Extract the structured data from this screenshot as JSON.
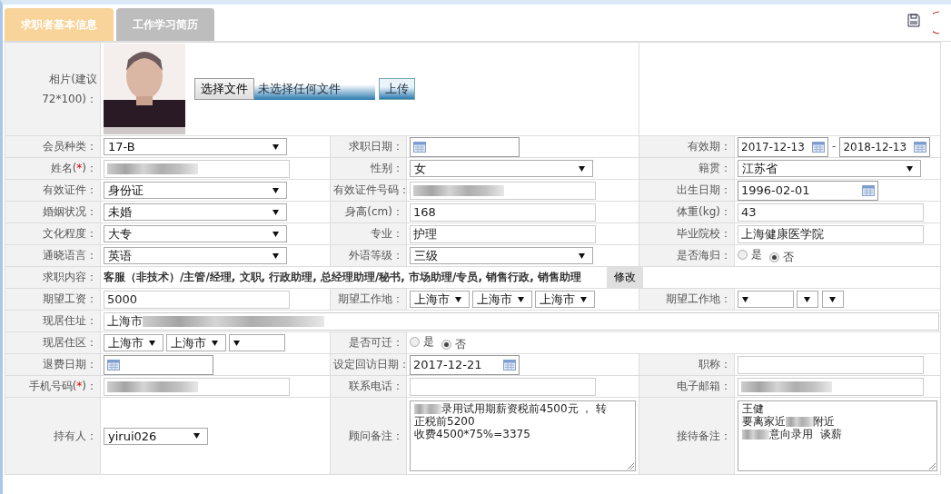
{
  "tabs": [
    {
      "label": "求职者基本信息",
      "selected": true
    },
    {
      "label": "工作学习简历",
      "selected": false
    }
  ],
  "photo": {
    "label_lines": [
      "相片(建议",
      "72*100)："
    ],
    "file_button": "选择文件",
    "file_status": "未选择任何文件",
    "upload_button": "上传"
  },
  "rows": [
    {
      "cells": [
        {
          "label": "会员种类：",
          "kind": "select",
          "value": "17-B"
        },
        {
          "label": "求职日期：",
          "kind": "date"
        },
        {
          "label": "有效期：",
          "kind": "daterange",
          "from": "2017-12-13",
          "separator": "-",
          "to": "2018-12-13"
        }
      ]
    },
    {
      "cells": [
        {
          "label": "姓名(",
          "required_mark": "*",
          "label_end": ")：",
          "kind": "text",
          "redacted": true
        },
        {
          "label": "性别：",
          "kind": "select",
          "value": "女"
        },
        {
          "label": "籍贯：",
          "kind": "select",
          "value": "江苏省"
        }
      ]
    },
    {
      "cells": [
        {
          "label": "有效证件：",
          "kind": "select",
          "value": "身份证"
        },
        {
          "label": "有效证件号码：",
          "kind": "text",
          "redacted": true
        },
        {
          "label": "出生日期：",
          "kind": "date",
          "value": "1996-02-01"
        }
      ]
    },
    {
      "cells": [
        {
          "label": "婚姻状况：",
          "kind": "select",
          "value": "未婚"
        },
        {
          "label": "身高(cm)：",
          "kind": "text",
          "value": "168"
        },
        {
          "label": "体重(kg)：",
          "kind": "text",
          "value": "43"
        }
      ]
    },
    {
      "cells": [
        {
          "label": "文化程度：",
          "kind": "select",
          "value": "大专"
        },
        {
          "label": "专业：",
          "kind": "text",
          "value": "护理"
        },
        {
          "label": "毕业院校：",
          "kind": "text",
          "value": "上海健康医学院"
        }
      ]
    },
    {
      "cells": [
        {
          "label": "通晓语言：",
          "kind": "select",
          "value": "英语"
        },
        {
          "label": "外语等级：",
          "kind": "select",
          "value": "三级"
        },
        {
          "label": "是否海归：",
          "kind": "radio",
          "options": [
            {
              "label": "是",
              "selected": false
            },
            {
              "label": "否",
              "selected": true
            }
          ]
        }
      ]
    },
    {
      "cells": [
        {
          "label": "求职内容：",
          "kind": "tags",
          "value": "客服（非技术）/主管/经理, 文职, 行政助理, 总经理助理/秘书, 市场助理/专员, 销售行政, 销售助理",
          "button": "修改"
        }
      ]
    },
    {
      "cells": [
        {
          "label": "期望工资：",
          "kind": "text",
          "value": "5000"
        },
        {
          "label": "期望工作地：",
          "kind": "selects",
          "selects": [
            {
              "value": "上海市"
            },
            {
              "value": "上海市"
            },
            {
              "value": "上海市"
            }
          ]
        },
        {
          "label": "期望工作地：",
          "kind": "selects",
          "selects": [
            {
              "blank": true
            },
            {
              "blank": true
            },
            {
              "blank": true
            }
          ]
        }
      ]
    },
    {
      "cells": [
        {
          "label": "现居住址：",
          "kind": "wide",
          "value": "上海市",
          "redacted": true
        }
      ]
    },
    {
      "cells": [
        {
          "label": "现居住区：",
          "kind": "selects",
          "selects": [
            {
              "value": "上海市"
            },
            {
              "value": "上海市"
            },
            {
              "blank": true
            }
          ]
        },
        {
          "label": "是否可迁：",
          "kind": "radio",
          "span": true,
          "options": [
            {
              "label": "是",
              "selected": false
            },
            {
              "label": "否",
              "selected": true
            }
          ]
        }
      ]
    },
    {
      "cells": [
        {
          "label": "退费日期：",
          "kind": "date"
        },
        {
          "label": "设定回访日期：",
          "kind": "date",
          "value": "2017-12-21"
        },
        {
          "label": "职称：",
          "kind": "text"
        }
      ]
    },
    {
      "cells": [
        {
          "label": "手机号码(",
          "required_mark": "*",
          "label_end": ")：",
          "kind": "text",
          "redacted": true
        },
        {
          "label": "联系电话：",
          "kind": "text"
        },
        {
          "label": "电子邮箱：",
          "kind": "text",
          "redacted": true
        }
      ]
    },
    {
      "cells": [
        {
          "label": "持有人：",
          "kind": "select",
          "value": "yirui026"
        },
        {
          "label": "顾问备注：",
          "kind": "textarea",
          "lines": [
            [
              {
                "kind": "redacted"
              },
              {
                "text": "录用试用期薪资税前4500元 ， 转"
              }
            ],
            [
              {
                "text": "正税前5200"
              }
            ],
            [
              {
                "text": "收费4500*75%=3375"
              }
            ]
          ]
        },
        {
          "label": "接待备注：",
          "kind": "textarea",
          "lines": [
            [
              {
                "text": "王健"
              }
            ],
            [
              {
                "text": "要离家近"
              },
              {
                "kind": "redacted"
              },
              {
                "text": "附近"
              }
            ],
            [
              {
                "kind": "redacted"
              },
              {
                "text": "意向录用  谈薪"
              }
            ]
          ]
        }
      ]
    }
  ]
}
